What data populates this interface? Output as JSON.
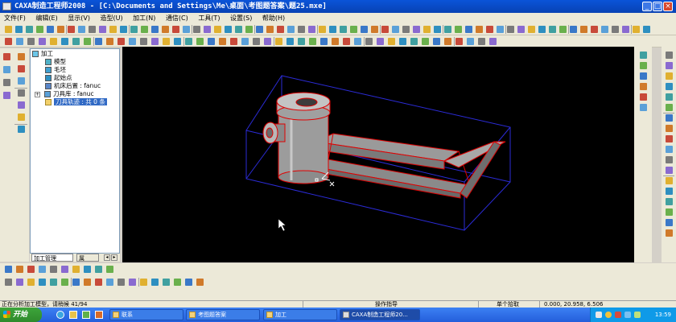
{
  "window": {
    "title": "CAXA制造工程师2008  - [C:\\Documents and Settings\\Me\\桌面\\考图题答案\\题25.mxe]",
    "controls": [
      "_",
      "□",
      "×"
    ]
  },
  "menu": [
    "文件(F)",
    "编辑(E)",
    "显示(V)",
    "造型(U)",
    "加工(N)",
    "通信(C)",
    "工具(T)",
    "设置(S)",
    "帮助(H)"
  ],
  "tree": {
    "root": "加工",
    "items": [
      {
        "label": "模型",
        "icon": "model-icon"
      },
      {
        "label": "毛坯",
        "icon": "blank-icon"
      },
      {
        "label": "起始点",
        "icon": "start-point-icon"
      },
      {
        "label": "机床后置 : fanuc",
        "icon": "machine-post-icon"
      },
      {
        "label": "刀具库 : fanuc",
        "icon": "tool-library-icon"
      },
      {
        "label": "刀具轨迹 : 共 0 条",
        "icon": "toolpath-folder-icon"
      }
    ],
    "tabs": [
      "加工管理",
      "属"
    ]
  },
  "status": {
    "left": "正在分析加工模型，请稍候  41/94",
    "hint": "操作指导",
    "mode": "单个拾取",
    "coords": "0.000, 20.958, 6.506"
  },
  "taskbar": {
    "start": "开始",
    "buttons": [
      "联系",
      "考图题答案",
      "加工",
      "CAXA制造工程师20..."
    ],
    "clock": "13:59"
  },
  "colors": {
    "title_bar": "#0a54d8",
    "viewport_bg": "#000000",
    "box_edge": "#2b2bd6",
    "model_outline": "#e00000",
    "model_fill": "#9a9a9a",
    "taskbar": "#245edb"
  }
}
